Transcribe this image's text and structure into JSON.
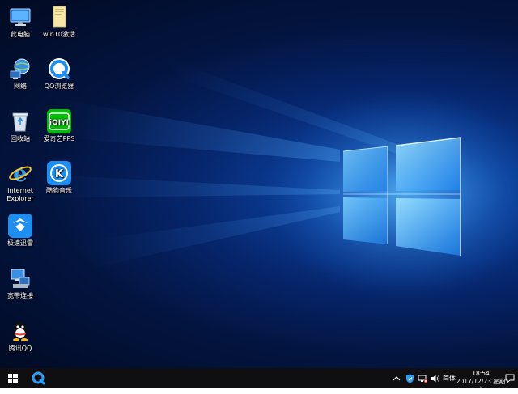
{
  "desktop": {
    "icons": [
      {
        "label": "此电脑",
        "icon": "this-pc-icon"
      },
      {
        "label": "win10激活",
        "icon": "folder-icon"
      },
      {
        "label": "网络",
        "icon": "network-icon"
      },
      {
        "label": "QQ浏览器",
        "icon": "qq-browser-icon"
      },
      {
        "label": "回收站",
        "icon": "recycle-bin-icon"
      },
      {
        "label": "爱奇艺PPS",
        "icon": "iqiyi-icon"
      },
      {
        "label": "Internet Explorer",
        "icon": "internet-explorer-icon"
      },
      {
        "label": "酷狗音乐",
        "icon": "kugou-icon"
      },
      {
        "label": "极速迅雷",
        "icon": "xunlei-icon"
      },
      {
        "label": "宽带连接",
        "icon": "broadband-icon"
      },
      {
        "label": "腾讯QQ",
        "icon": "qq-icon"
      }
    ]
  },
  "taskbar": {
    "start_icon": "windows-logo-icon",
    "pinned": [
      {
        "icon": "qq-browser-icon"
      }
    ],
    "tray": {
      "overflow_icon": "chevron-up-icon",
      "security_icon": "shield-icon",
      "network_icon": "network-status-icon",
      "volume_icon": "speaker-icon",
      "ime_label": "简体",
      "notification_icon": "notification-icon"
    },
    "clock": {
      "time": "18:54",
      "date": "2017/12/23 星期六"
    }
  },
  "colors": {
    "taskbar_bg": "#0f0f12",
    "wallpaper_accent": "#1f6fd6"
  }
}
